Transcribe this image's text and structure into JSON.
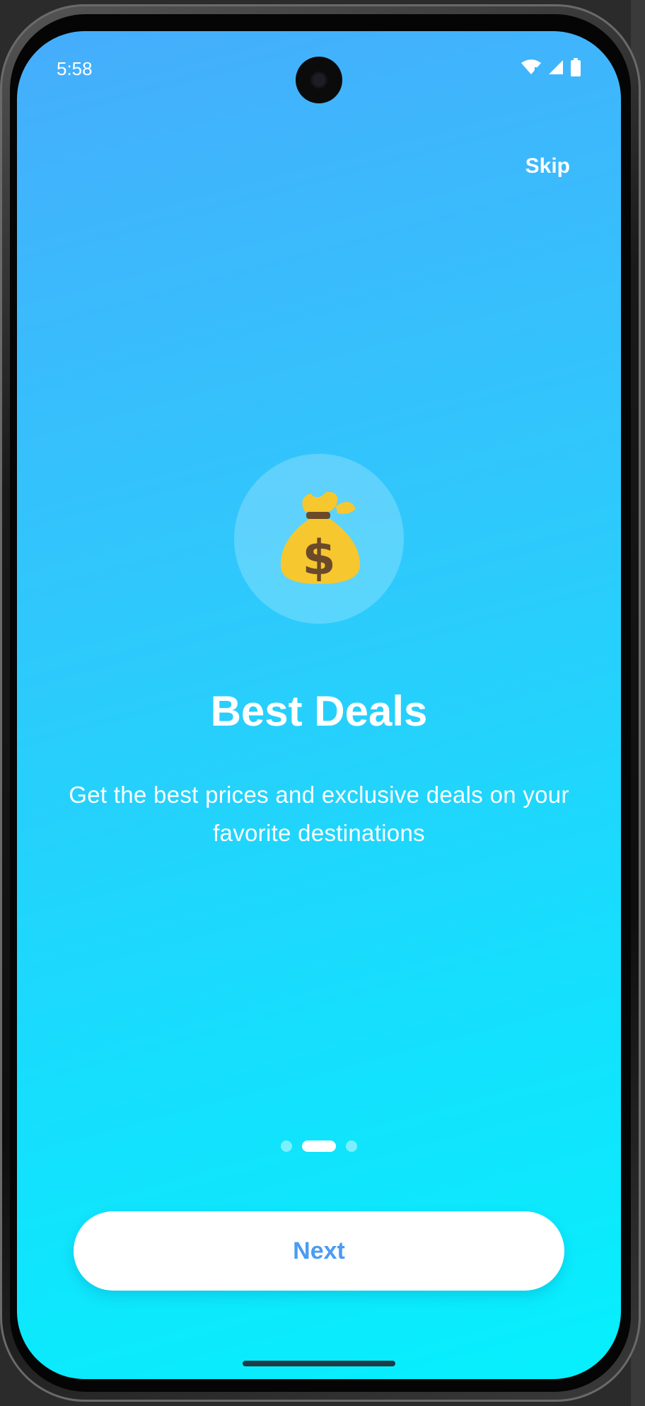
{
  "status_bar": {
    "time": "5:58",
    "icons": [
      "wifi-icon",
      "signal-icon",
      "battery-icon"
    ]
  },
  "onboarding": {
    "skip_label": "Skip",
    "hero_icon": "money-bag-icon",
    "title": "Best Deals",
    "description": "Get the best prices and exclusive deals on your favorite destinations",
    "page_indicator": {
      "total": 3,
      "current": 2
    },
    "next_label": "Next"
  },
  "colors": {
    "gradient_top": "#46adfc",
    "gradient_bottom": "#06f0fd",
    "button_text": "#4a9cf2",
    "text": "#ffffff"
  }
}
